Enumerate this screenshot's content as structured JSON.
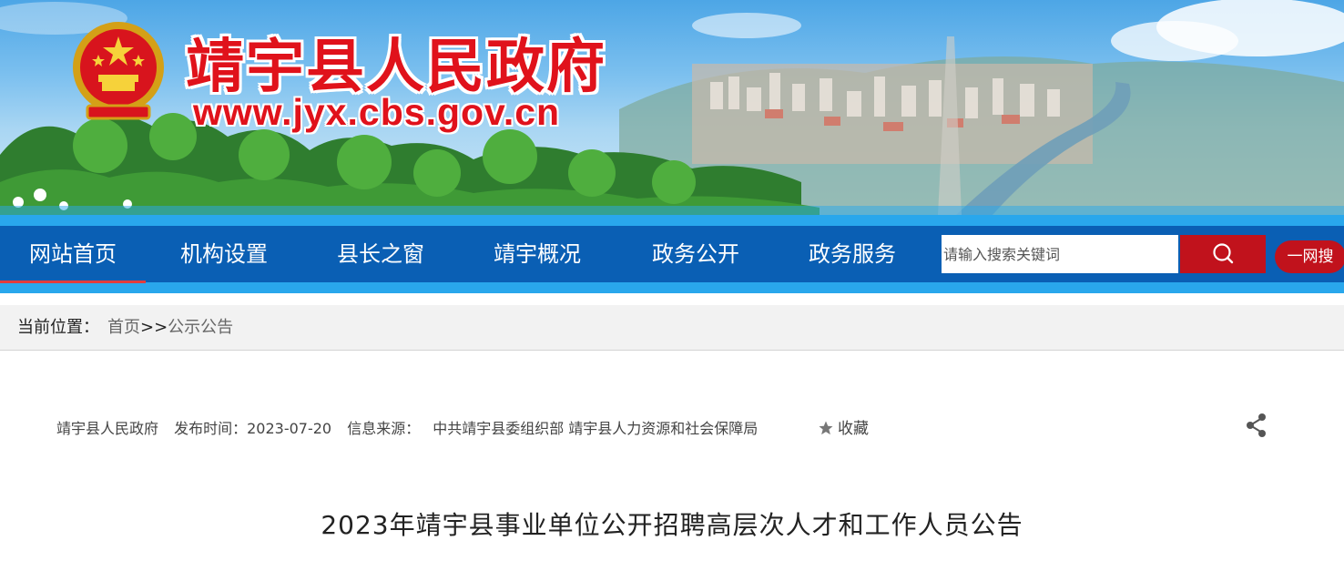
{
  "header": {
    "site_title": "靖宇县人民政府",
    "site_url": "www.jyx.cbs.gov.cn",
    "emblem_icon": "national-emblem-icon"
  },
  "nav": {
    "items": [
      {
        "label": "网站首页",
        "active": true
      },
      {
        "label": "机构设置"
      },
      {
        "label": "县长之窗"
      },
      {
        "label": "靖宇概况"
      },
      {
        "label": "政务公开"
      },
      {
        "label": "政务服务"
      }
    ],
    "search_placeholder": "请输入搜索关键词",
    "search_icon": "search-icon",
    "yiwang_label": "一网搜"
  },
  "breadcrumb": {
    "label": "当前位置：",
    "home": "首页",
    "separator": ">>",
    "current": "公示公告"
  },
  "article": {
    "publisher": "靖宇县人民政府",
    "publish_time": "发布时间：2023-07-20",
    "source_label": "信息来源：",
    "source": "中共靖宇县委组织部 靖宇县人力资源和社会保障局",
    "favorite_label": "收藏",
    "share_icon": "share-icon",
    "title": "2023年靖宇县事业单位公开招聘高层次人才和工作人员公告"
  },
  "colors": {
    "nav_bg": "#0a5fb4",
    "nav_strip": "#29a7ec",
    "accent_red": "#c1121c",
    "title_red": "#e0121b"
  }
}
